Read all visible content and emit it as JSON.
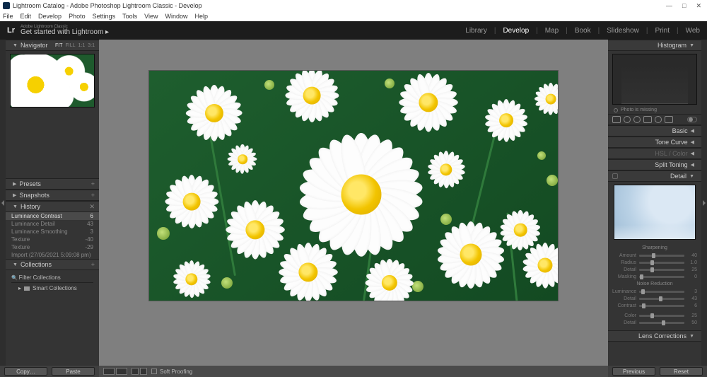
{
  "window": {
    "title": "Lightroom Catalog - Adobe Photoshop Lightroom Classic - Develop",
    "controls": {
      "min": "—",
      "max": "□",
      "close": "✕"
    }
  },
  "menubar": [
    "File",
    "Edit",
    "Develop",
    "Photo",
    "Settings",
    "Tools",
    "View",
    "Window",
    "Help"
  ],
  "brand": {
    "line1": "Adobe Lightroom Classic",
    "line2": "Get started with Lightroom ▸",
    "logo": "Lr"
  },
  "modules": [
    "Library",
    "Develop",
    "Map",
    "Book",
    "Slideshow",
    "Print",
    "Web"
  ],
  "activeModule": "Develop",
  "leftPanels": {
    "navigator": {
      "label": "Navigator",
      "opts": [
        "FIT",
        "FILL",
        "1:1",
        "3:1"
      ],
      "activeOpt": "FIT"
    },
    "presets": {
      "label": "Presets"
    },
    "snapshots": {
      "label": "Snapshots"
    },
    "history": {
      "label": "History",
      "items": [
        {
          "name": "Luminance Contrast",
          "val": "6",
          "active": true
        },
        {
          "name": "Luminance Detail",
          "val": "43"
        },
        {
          "name": "Luminance Smoothing",
          "val": "3"
        },
        {
          "name": "Texture",
          "val": "-40"
        },
        {
          "name": "Texture",
          "val": "-29"
        },
        {
          "name": "Import (27/05/2021 5:09:08 pm)",
          "val": ""
        }
      ]
    },
    "collections": {
      "label": "Collections",
      "filter": "Filter Collections",
      "smart": "Smart Collections"
    }
  },
  "rightPanels": {
    "histogram": {
      "label": "Histogram",
      "note": "Photo is missing"
    },
    "sections": [
      "Basic",
      "Tone Curve",
      "HSL / Color",
      "Split Toning",
      "Detail"
    ],
    "activeSection": "Detail",
    "detail": {
      "sharpTitle": "Sharpening",
      "sharp": [
        {
          "lbl": "Amount",
          "val": "40",
          "pos": 28
        },
        {
          "lbl": "Radius",
          "val": "1.0",
          "pos": 25
        },
        {
          "lbl": "Detail",
          "val": "25",
          "pos": 25
        },
        {
          "lbl": "Masking",
          "val": "0",
          "pos": 2
        }
      ],
      "noiseTitle": "Noise Reduction",
      "noise": [
        {
          "lbl": "Luminance",
          "val": "3",
          "pos": 5
        },
        {
          "lbl": "Detail",
          "val": "43",
          "pos": 43
        },
        {
          "lbl": "Contrast",
          "val": "6",
          "pos": 6
        }
      ],
      "color": [
        {
          "lbl": "Color",
          "val": "25",
          "pos": 25
        },
        {
          "lbl": "Detail",
          "val": "50",
          "pos": 50
        }
      ]
    },
    "lensCorr": "Lens Corrections"
  },
  "bottom": {
    "copy": "Copy…",
    "paste": "Paste",
    "soft": "Soft Proofing",
    "prev": "Previous",
    "reset": "Reset"
  }
}
